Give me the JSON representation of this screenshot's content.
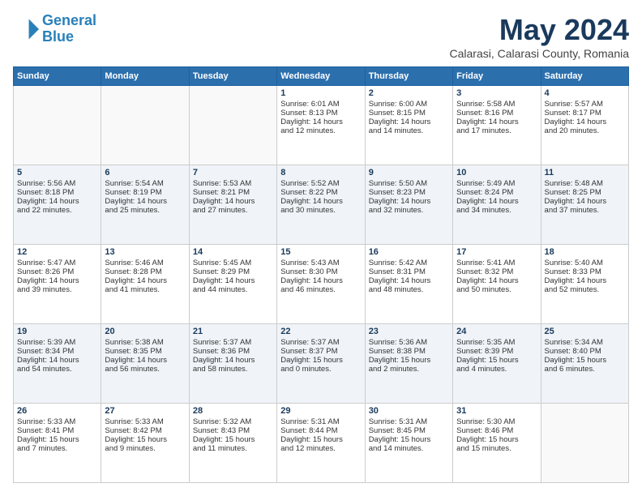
{
  "logo": {
    "line1": "General",
    "line2": "Blue"
  },
  "title": "May 2024",
  "location": "Calarasi, Calarasi County, Romania",
  "days_header": [
    "Sunday",
    "Monday",
    "Tuesday",
    "Wednesday",
    "Thursday",
    "Friday",
    "Saturday"
  ],
  "weeks": [
    {
      "cells": [
        {
          "day": "",
          "info": ""
        },
        {
          "day": "",
          "info": ""
        },
        {
          "day": "",
          "info": ""
        },
        {
          "day": "1",
          "info": "Sunrise: 6:01 AM\nSunset: 8:13 PM\nDaylight: 14 hours\nand 12 minutes."
        },
        {
          "day": "2",
          "info": "Sunrise: 6:00 AM\nSunset: 8:15 PM\nDaylight: 14 hours\nand 14 minutes."
        },
        {
          "day": "3",
          "info": "Sunrise: 5:58 AM\nSunset: 8:16 PM\nDaylight: 14 hours\nand 17 minutes."
        },
        {
          "day": "4",
          "info": "Sunrise: 5:57 AM\nSunset: 8:17 PM\nDaylight: 14 hours\nand 20 minutes."
        }
      ]
    },
    {
      "cells": [
        {
          "day": "5",
          "info": "Sunrise: 5:56 AM\nSunset: 8:18 PM\nDaylight: 14 hours\nand 22 minutes."
        },
        {
          "day": "6",
          "info": "Sunrise: 5:54 AM\nSunset: 8:19 PM\nDaylight: 14 hours\nand 25 minutes."
        },
        {
          "day": "7",
          "info": "Sunrise: 5:53 AM\nSunset: 8:21 PM\nDaylight: 14 hours\nand 27 minutes."
        },
        {
          "day": "8",
          "info": "Sunrise: 5:52 AM\nSunset: 8:22 PM\nDaylight: 14 hours\nand 30 minutes."
        },
        {
          "day": "9",
          "info": "Sunrise: 5:50 AM\nSunset: 8:23 PM\nDaylight: 14 hours\nand 32 minutes."
        },
        {
          "day": "10",
          "info": "Sunrise: 5:49 AM\nSunset: 8:24 PM\nDaylight: 14 hours\nand 34 minutes."
        },
        {
          "day": "11",
          "info": "Sunrise: 5:48 AM\nSunset: 8:25 PM\nDaylight: 14 hours\nand 37 minutes."
        }
      ]
    },
    {
      "cells": [
        {
          "day": "12",
          "info": "Sunrise: 5:47 AM\nSunset: 8:26 PM\nDaylight: 14 hours\nand 39 minutes."
        },
        {
          "day": "13",
          "info": "Sunrise: 5:46 AM\nSunset: 8:28 PM\nDaylight: 14 hours\nand 41 minutes."
        },
        {
          "day": "14",
          "info": "Sunrise: 5:45 AM\nSunset: 8:29 PM\nDaylight: 14 hours\nand 44 minutes."
        },
        {
          "day": "15",
          "info": "Sunrise: 5:43 AM\nSunset: 8:30 PM\nDaylight: 14 hours\nand 46 minutes."
        },
        {
          "day": "16",
          "info": "Sunrise: 5:42 AM\nSunset: 8:31 PM\nDaylight: 14 hours\nand 48 minutes."
        },
        {
          "day": "17",
          "info": "Sunrise: 5:41 AM\nSunset: 8:32 PM\nDaylight: 14 hours\nand 50 minutes."
        },
        {
          "day": "18",
          "info": "Sunrise: 5:40 AM\nSunset: 8:33 PM\nDaylight: 14 hours\nand 52 minutes."
        }
      ]
    },
    {
      "cells": [
        {
          "day": "19",
          "info": "Sunrise: 5:39 AM\nSunset: 8:34 PM\nDaylight: 14 hours\nand 54 minutes."
        },
        {
          "day": "20",
          "info": "Sunrise: 5:38 AM\nSunset: 8:35 PM\nDaylight: 14 hours\nand 56 minutes."
        },
        {
          "day": "21",
          "info": "Sunrise: 5:37 AM\nSunset: 8:36 PM\nDaylight: 14 hours\nand 58 minutes."
        },
        {
          "day": "22",
          "info": "Sunrise: 5:37 AM\nSunset: 8:37 PM\nDaylight: 15 hours\nand 0 minutes."
        },
        {
          "day": "23",
          "info": "Sunrise: 5:36 AM\nSunset: 8:38 PM\nDaylight: 15 hours\nand 2 minutes."
        },
        {
          "day": "24",
          "info": "Sunrise: 5:35 AM\nSunset: 8:39 PM\nDaylight: 15 hours\nand 4 minutes."
        },
        {
          "day": "25",
          "info": "Sunrise: 5:34 AM\nSunset: 8:40 PM\nDaylight: 15 hours\nand 6 minutes."
        }
      ]
    },
    {
      "cells": [
        {
          "day": "26",
          "info": "Sunrise: 5:33 AM\nSunset: 8:41 PM\nDaylight: 15 hours\nand 7 minutes."
        },
        {
          "day": "27",
          "info": "Sunrise: 5:33 AM\nSunset: 8:42 PM\nDaylight: 15 hours\nand 9 minutes."
        },
        {
          "day": "28",
          "info": "Sunrise: 5:32 AM\nSunset: 8:43 PM\nDaylight: 15 hours\nand 11 minutes."
        },
        {
          "day": "29",
          "info": "Sunrise: 5:31 AM\nSunset: 8:44 PM\nDaylight: 15 hours\nand 12 minutes."
        },
        {
          "day": "30",
          "info": "Sunrise: 5:31 AM\nSunset: 8:45 PM\nDaylight: 15 hours\nand 14 minutes."
        },
        {
          "day": "31",
          "info": "Sunrise: 5:30 AM\nSunset: 8:46 PM\nDaylight: 15 hours\nand 15 minutes."
        },
        {
          "day": "",
          "info": ""
        }
      ]
    }
  ]
}
